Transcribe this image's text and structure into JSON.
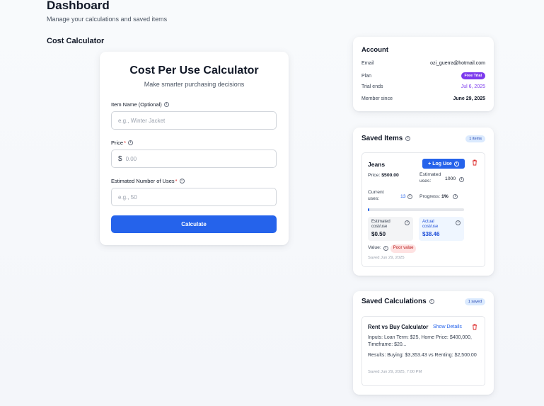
{
  "header": {
    "title": "Dashboard",
    "subtitle": "Manage your calculations and saved items",
    "section_title": "Cost Calculator"
  },
  "calculator": {
    "title": "Cost Per Use Calculator",
    "subtitle": "Make smarter purchasing decisions",
    "item_name_label": "Item Name (Optional)",
    "item_name_placeholder": "e.g., Winter Jacket",
    "price_label": "Price",
    "price_required": "*",
    "price_currency": "$",
    "price_placeholder": "0.00",
    "uses_label": "Estimated Number of Uses",
    "uses_required": "*",
    "uses_placeholder": "e.g., 50",
    "button_label": "Calculate"
  },
  "account": {
    "title": "Account",
    "email_label": "Email",
    "email_value": "ozi_guerra@hotmail.com",
    "plan_label": "Plan",
    "plan_value": "Free Trial",
    "trial_label": "Trial ends",
    "trial_value": "Jul 6, 2025",
    "member_label": "Member since",
    "member_value": "June 29, 2025",
    "accent_color": "#7c3aed"
  },
  "saved_items": {
    "title": "Saved Items",
    "count": "1 items",
    "items": [
      {
        "name": "Jeans",
        "log_button": "+ Log Use",
        "price_label": "Price:",
        "price_value": "$500.00",
        "est_uses_label": "Estimated uses:",
        "est_uses_value": "1000",
        "current_uses_label": "Current uses:",
        "current_uses_value": "13",
        "progress_label": "Progress:",
        "progress_value": "1%",
        "progress_fraction": 0.013,
        "est_cost_label": "Estimated cost/use",
        "est_cost_value": "$0.50",
        "actual_cost_label": "Actual cost/use",
        "actual_cost_value": "$38.46",
        "value_label": "Value:",
        "value_badge": "Poor value",
        "saved_date": "Saved Jun 29, 2025"
      }
    ]
  },
  "saved_calculations": {
    "title": "Saved Calculations",
    "count": "1 saved",
    "items": [
      {
        "name": "Rent vs Buy Calculator",
        "show_details": "Show Details",
        "inputs": "Inputs: Loan Term: $25, Home Price: $400,000, Timeframe: $20...",
        "results": "Results: Buying: $3,353.43 vs Renting: $2,500.00",
        "saved_date": "Saved Jun 29, 2025, 7:00 PM"
      }
    ]
  },
  "icons": {
    "info": "info-icon",
    "trash": "trash-icon"
  },
  "colors": {
    "primary": "#2563eb",
    "danger": "#dc2626",
    "trial_badge": "#7c3aed"
  }
}
